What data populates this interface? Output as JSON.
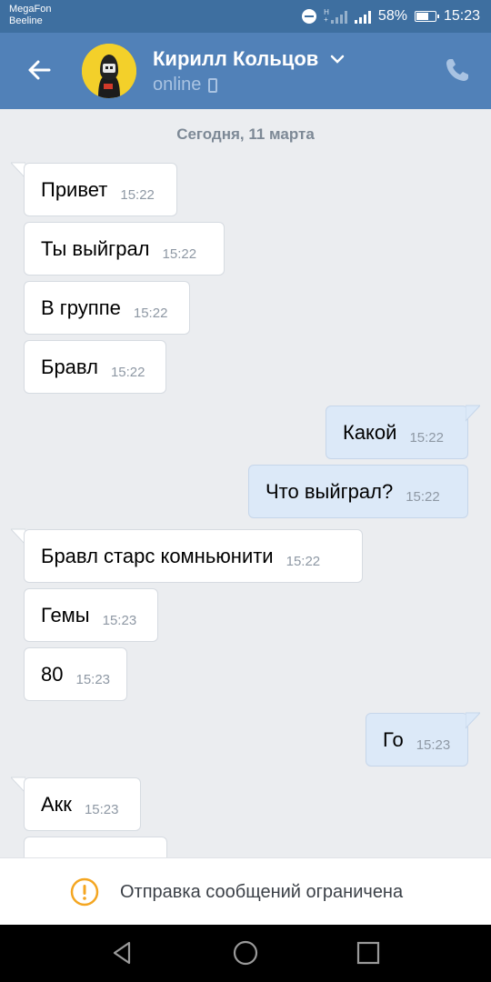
{
  "status_bar": {
    "carrier_1": "MegaFon",
    "carrier_2": "Beeline",
    "battery": "58%",
    "time": "15:23"
  },
  "header": {
    "contact_name": "Кирилл Кольцов",
    "presence": "online",
    "icons": [
      "back-arrow-icon",
      "chevron-down-icon",
      "mobile-icon",
      "call-icon"
    ]
  },
  "chat": {
    "date_divider": "Сегодня, 11 марта",
    "messages": [
      {
        "text": "Привет",
        "time": "15:22",
        "direction": "in"
      },
      {
        "text": "Ты выйграл",
        "time": "15:22",
        "direction": "in"
      },
      {
        "text": "В группе",
        "time": "15:22",
        "direction": "in"
      },
      {
        "text": "Бравл",
        "time": "15:22",
        "direction": "in"
      },
      {
        "text": "Какой",
        "time": "15:22",
        "direction": "out"
      },
      {
        "text": "Что выйграл?",
        "time": "15:22",
        "direction": "out"
      },
      {
        "text": "Бравл старс комньюнити",
        "time": "15:22",
        "direction": "in"
      },
      {
        "text": "Гемы",
        "time": "15:23",
        "direction": "in"
      },
      {
        "text": "80",
        "time": "15:23",
        "direction": "in"
      },
      {
        "text": "Го",
        "time": "15:23",
        "direction": "out"
      },
      {
        "text": "Акк",
        "time": "15:23",
        "direction": "in"
      }
    ]
  },
  "footer": {
    "notice": "Отправка сообщений ограничена"
  },
  "colors": {
    "header_bg": "#5181b8",
    "status_bar_bg": "#3e6fa0",
    "outgoing_bubble": "#dce9f8",
    "warning": "#f4a621"
  }
}
